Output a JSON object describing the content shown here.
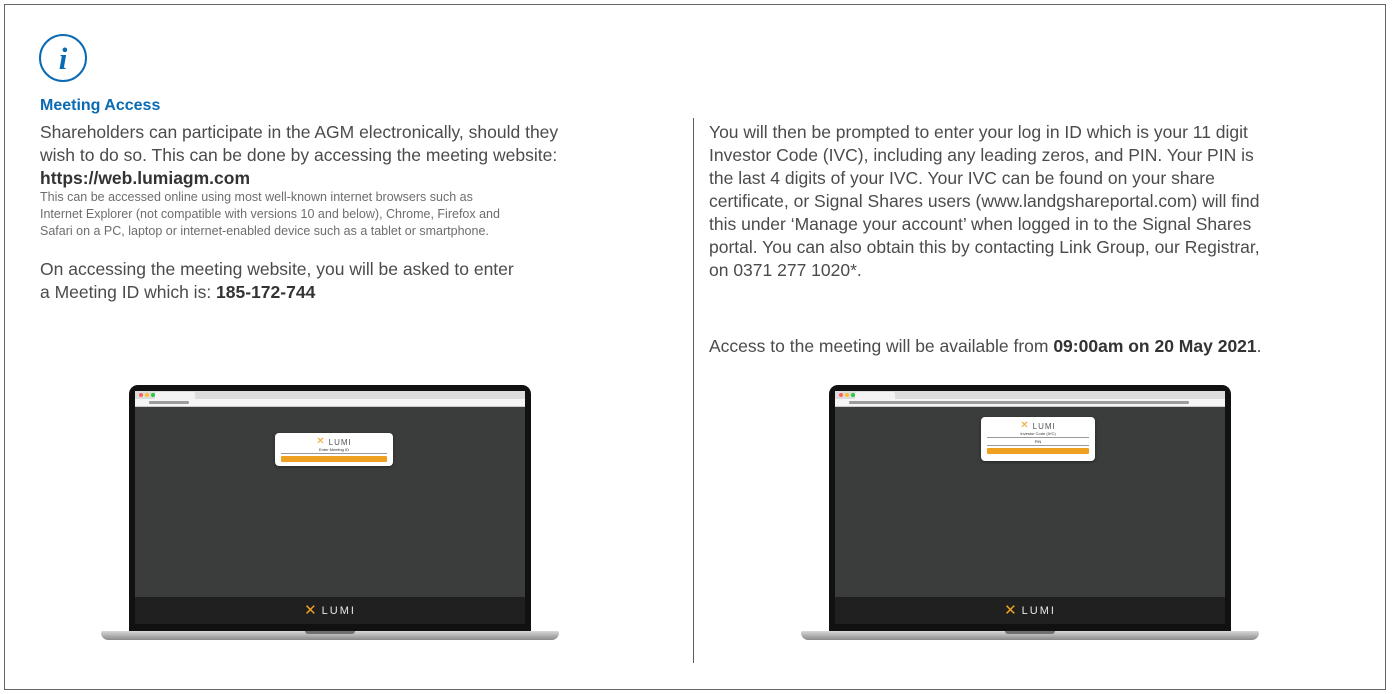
{
  "icon": {
    "name": "info-icon",
    "glyph": "i",
    "color": "#0a6ab3"
  },
  "left": {
    "heading": "Meeting Access",
    "intro_line1": "Shareholders can participate in the AGM electronically, should they",
    "intro_line2": "wish to do so. This can be done by accessing the meeting website:",
    "url": "https://web.lumiagm.com",
    "browsers_line1": "This can be accessed online using most well-known internet browsers such as",
    "browsers_line2": "Internet Explorer (not compatible with versions 10 and below), Chrome, Firefox and",
    "browsers_line3": "Safari on a PC, laptop or internet-enabled device such as a tablet or smartphone.",
    "meeting_line1": "On accessing the meeting website, you will be asked to enter",
    "meeting_line2_prefix": "a Meeting ID which is: ",
    "meeting_id": "185-172-744"
  },
  "right": {
    "login_line1": "You will then be prompted to enter your log in ID which is your 11 digit",
    "login_line2": "Investor Code (IVC), including any leading zeros, and PIN. Your PIN is",
    "login_line3": "the last 4 digits of your IVC. Your IVC can be found on your share",
    "login_line4": "certificate, or Signal Shares users (www.landgshareportal.com) will find",
    "login_line5": "this under ‘Manage your account’ when logged in to the Signal Shares",
    "login_line6": "portal. You can also obtain this by contacting Link Group, our Registrar,",
    "login_line7": "on 0371 277 1020*.",
    "access_prefix": "Access to the meeting will be available from ",
    "access_time": "09:00am on 20 May 2021",
    "access_suffix": "."
  },
  "laptop1": {
    "logo": "LUMI",
    "field_label": "Enter Meeting ID",
    "bezel_logo": "LUMI"
  },
  "laptop2": {
    "logo": "LUMI",
    "field1_label": "Investor Code (IVC)",
    "field2_label": "PIN",
    "bezel_logo": "LUMI"
  },
  "colors": {
    "accent_blue": "#0a6ab3",
    "lumi_orange": "#f0a020",
    "screen_bg": "#3a3d3b"
  }
}
